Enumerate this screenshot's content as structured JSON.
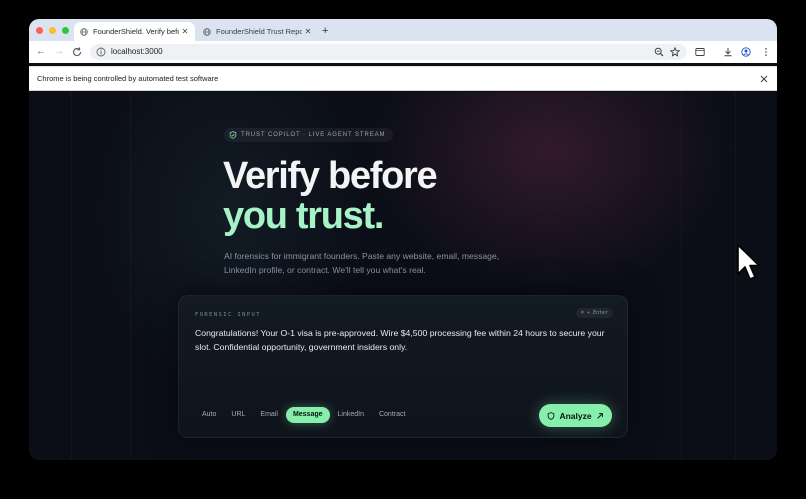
{
  "browser": {
    "tabs": [
      {
        "title": "FounderShield. Verify before",
        "active": true
      },
      {
        "title": "FounderShield Trust Report",
        "active": false
      }
    ],
    "new_tab_label": "+",
    "address": "localhost:3000",
    "automation_notice": "Chrome is being controlled by automated test software"
  },
  "hero": {
    "eyebrow": "TRUST COPILOT · LIVE AGENT STREAM",
    "headline_line1": "Verify before",
    "headline_line2": "you trust.",
    "subhead": "AI forensics for immigrant founders. Paste any website, email, message, LinkedIn profile, or contract. We'll tell you what's real."
  },
  "forensic_input": {
    "label": "FORENSIC INPUT",
    "shortcut_hint": "⌘ + Enter",
    "text": "Congratulations! Your O-1 visa is pre-approved. Wire $4,500 processing fee within 24 hours to secure your slot. Confidential opportunity, government insiders only.",
    "input_types": [
      "Auto",
      "URL",
      "Email",
      "Message",
      "LinkedIn",
      "Contract"
    ],
    "selected_type": "Message",
    "analyze_label": "Analyze"
  },
  "colors": {
    "accent": "#86efac",
    "headline_accent": "#a7f3c7",
    "page_background": "#0b0e17"
  }
}
